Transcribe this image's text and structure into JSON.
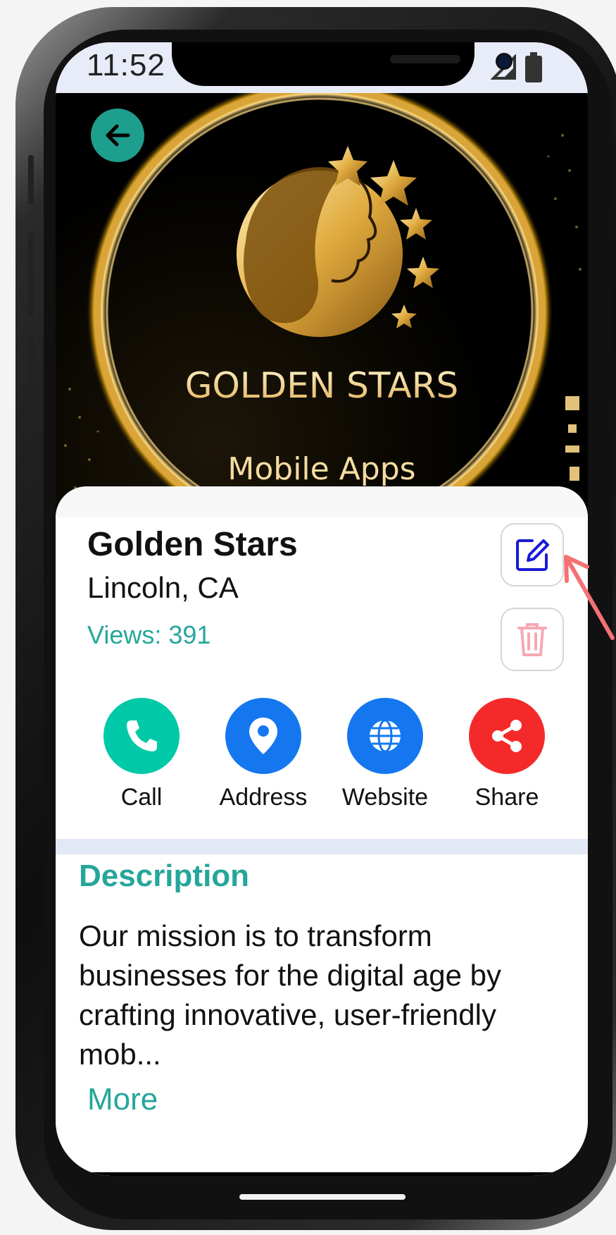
{
  "status_bar": {
    "time": "11:52",
    "icons": [
      "signal-icon",
      "battery-icon"
    ]
  },
  "header": {
    "back_icon": "arrow-left-icon",
    "logo_title": "GOLDEN STARS",
    "logo_subtitle": "Mobile Apps"
  },
  "business": {
    "name": "Golden Stars",
    "location": "Lincoln, CA",
    "views": "Views: 391"
  },
  "card_actions": {
    "edit_icon": "edit-icon",
    "delete_icon": "trash-icon"
  },
  "actions": [
    {
      "label": "Call",
      "icon": "phone-icon",
      "color": "#00c9a7"
    },
    {
      "label": "Address",
      "icon": "map-pin-icon",
      "color": "#1477f0"
    },
    {
      "label": "Website",
      "icon": "globe-icon",
      "color": "#1477f0"
    },
    {
      "label": "Share",
      "icon": "share-icon",
      "color": "#f42a2a"
    }
  ],
  "description": {
    "title": "Description",
    "text": "Our mission is to transform businesses for the digital age by crafting innovative, user-friendly mob...",
    "more_label": "More"
  },
  "colors": {
    "accent": "#26a69a",
    "back_button": "#1e9e8c",
    "edit_icon": "#1a1ad6",
    "delete_icon": "#f6a8b4",
    "gold": "#e3b04b"
  }
}
